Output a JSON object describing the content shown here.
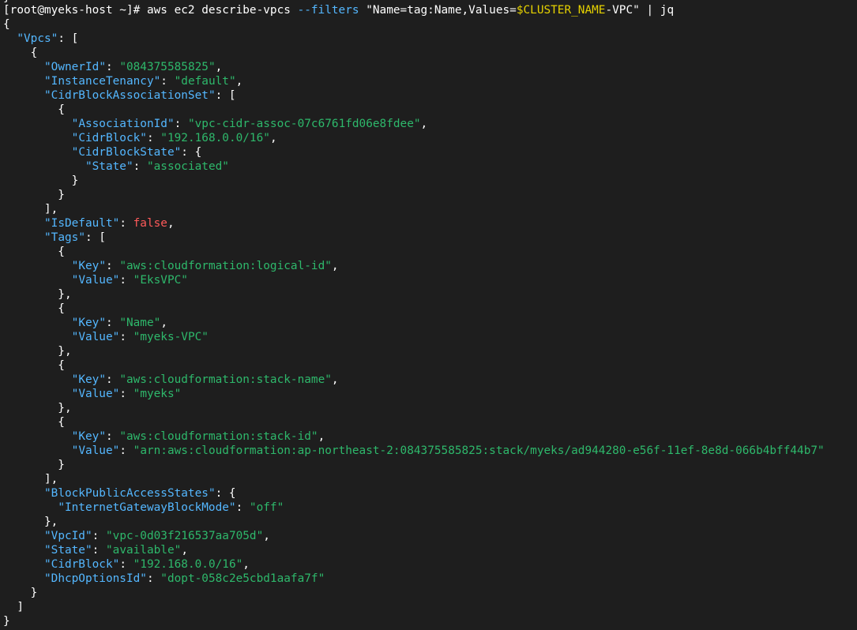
{
  "colors": {
    "background": "#1e1e1e",
    "key": "#54b7ff",
    "string": "#2eb86b",
    "boolean": "#ff5a5a",
    "env_var": "#e6d200",
    "text": "#ffffff"
  },
  "prompt": {
    "prefix": "[root@myeks-host ~]# ",
    "cmd_start": "aws ec2 describe-vpcs ",
    "flag": "--filters",
    "arg_start": " \"Name=tag:Name,Values=",
    "env_var": "$CLUSTER_NAME",
    "arg_end": "-VPC\" | jq"
  },
  "json": {
    "vpcs_key": "Vpcs",
    "owner_id_key": "OwnerId",
    "owner_id": "084375585825",
    "instance_tenancy_key": "InstanceTenancy",
    "instance_tenancy": "default",
    "cidr_assoc_set_key": "CidrBlockAssociationSet",
    "association_id_key": "AssociationId",
    "association_id": "vpc-cidr-assoc-07c6761fd06e8fdee",
    "assoc_cidr_key": "CidrBlock",
    "assoc_cidr": "192.168.0.0/16",
    "cidr_block_state_key": "CidrBlockState",
    "state_key": "State",
    "assoc_state": "associated",
    "is_default_key": "IsDefault",
    "is_default": "false",
    "tags_key": "Tags",
    "tag_key_label": "Key",
    "tag_value_label": "Value",
    "tags": [
      {
        "key": "aws:cloudformation:logical-id",
        "value": "EksVPC"
      },
      {
        "key": "Name",
        "value": "myeks-VPC"
      },
      {
        "key": "aws:cloudformation:stack-name",
        "value": "myeks"
      },
      {
        "key": "aws:cloudformation:stack-id",
        "value": "arn:aws:cloudformation:ap-northeast-2:084375585825:stack/myeks/ad944280-e56f-11ef-8e8d-066b4bff44b7"
      }
    ],
    "bpas_key": "BlockPublicAccessStates",
    "igw_block_mode_key": "InternetGatewayBlockMode",
    "igw_block_mode": "off",
    "vpc_id_key": "VpcId",
    "vpc_id": "vpc-0d03f216537aa705d",
    "state_label": "State",
    "state": "available",
    "cidr_key": "CidrBlock",
    "cidr": "192.168.0.0/16",
    "dhcp_key": "DhcpOptionsId",
    "dhcp": "dopt-058c2e5cbd1aafa7f"
  }
}
